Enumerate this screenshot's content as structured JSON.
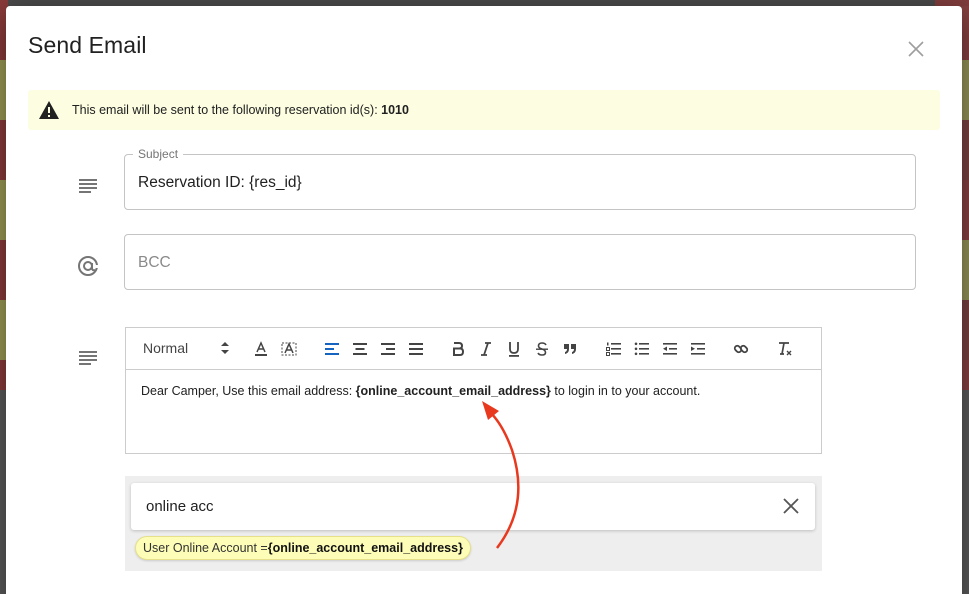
{
  "dialog": {
    "title": "Send Email"
  },
  "alert": {
    "message": "This email will be sent to the following reservation id(s): ",
    "reservation_ids": "1010",
    "icon": "warning-icon"
  },
  "subject": {
    "label": "Subject",
    "value": "Reservation ID: {res_id}",
    "icon": "notes-icon"
  },
  "bcc": {
    "placeholder": "BCC",
    "icon": "at-sign-icon"
  },
  "editor": {
    "icon": "notes-icon",
    "toolbar": {
      "format_select": "Normal",
      "buttons": [
        "text-color",
        "background-color",
        "align-left",
        "align-center",
        "align-right",
        "align-justify",
        "bold",
        "italic",
        "underline",
        "strike",
        "blockquote",
        "ordered-list",
        "bullet-list",
        "outdent",
        "indent",
        "link",
        "clean-format"
      ]
    },
    "body_prefix": "Dear Camper, Use this email address: ",
    "body_variable": "{online_account_email_address}",
    "body_suffix": " to login in to your account."
  },
  "variables": {
    "search_value": "online acc",
    "suggestion_label": "User Online Account = ",
    "suggestion_value": "{online_account_email_address}"
  },
  "colors": {
    "accent_blue": "#1565c0",
    "alert_bg": "#fdfde1",
    "chip_bg": "#fdfdb8",
    "annotation_red": "#e8391f"
  }
}
